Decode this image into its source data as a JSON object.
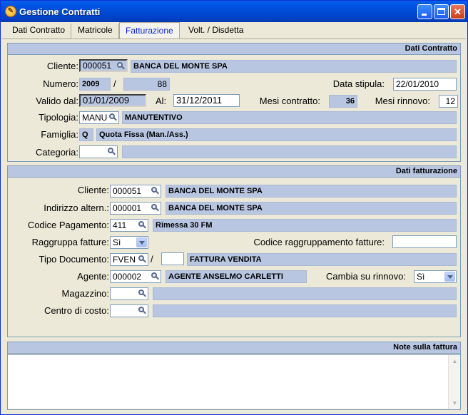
{
  "window": {
    "title": "Gestione Contratti"
  },
  "tabs": [
    "Dati Contratto",
    "Matricole",
    "Fatturazione",
    "Volt. / Disdetta"
  ],
  "contratto": {
    "header": "Dati Contratto",
    "cliente_label": "Cliente:",
    "cliente_code": "000051",
    "cliente_name": "BANCA DEL MONTE SPA",
    "numero_label": "Numero:",
    "numero_anno": "2009",
    "numero_sep": "/",
    "numero_num": "88",
    "data_stipula_label": "Data stipula:",
    "data_stipula": "22/01/2010",
    "valido_label": "Valido dal:",
    "valido_dal": "01/01/2009",
    "al_label": "Al:",
    "al": "31/12/2011",
    "mesi_contratto_label": "Mesi contratto:",
    "mesi_contratto": "36",
    "mesi_rinnovo_label": "Mesi rinnovo:",
    "mesi_rinnovo": "12",
    "tipologia_label": "Tipologia:",
    "tipologia_code": "MANU",
    "tipologia_name": "MANUTENTIVO",
    "famiglia_label": "Famiglia:",
    "famiglia_code": "Q",
    "famiglia_name": "Quota Fissa (Man./Ass.)",
    "categoria_label": "Categoria:",
    "categoria_code": "",
    "categoria_name": ""
  },
  "fatturazione": {
    "header": "Dati fatturazione",
    "cliente_label": "Cliente:",
    "cliente_code": "000051",
    "cliente_name": "BANCA DEL MONTE SPA",
    "indirizzo_label": "Indirizzo altern.:",
    "indirizzo_code": "000001",
    "indirizzo_name": "BANCA DEL MONTE SPA",
    "pagamento_label": "Codice Pagamento:",
    "pagamento_code": "411",
    "pagamento_name": "Rimessa 30 FM",
    "raggruppa_label": "Raggruppa fatture:",
    "raggruppa_value": "Sì",
    "codice_raggr_label": "Codice raggruppamento fatture:",
    "codice_raggr_value": "",
    "tipo_doc_label": "Tipo Documento:",
    "tipo_doc_code": "FVEN",
    "tipo_doc_sep": "/",
    "tipo_doc_extra": "",
    "tipo_doc_name": "FATTURA VENDITA",
    "agente_label": "Agente:",
    "agente_code": "000002",
    "agente_name": "AGENTE ANSELMO CARLETTI",
    "cambia_label": "Cambia su rinnovo:",
    "cambia_value": "Sì",
    "magazzino_label": "Magazzino:",
    "magazzino_code": "",
    "magazzino_name": "",
    "centro_label": "Centro di costo:",
    "centro_code": "",
    "centro_name": ""
  },
  "note": {
    "header": "Note sulla fattura",
    "text": ""
  }
}
